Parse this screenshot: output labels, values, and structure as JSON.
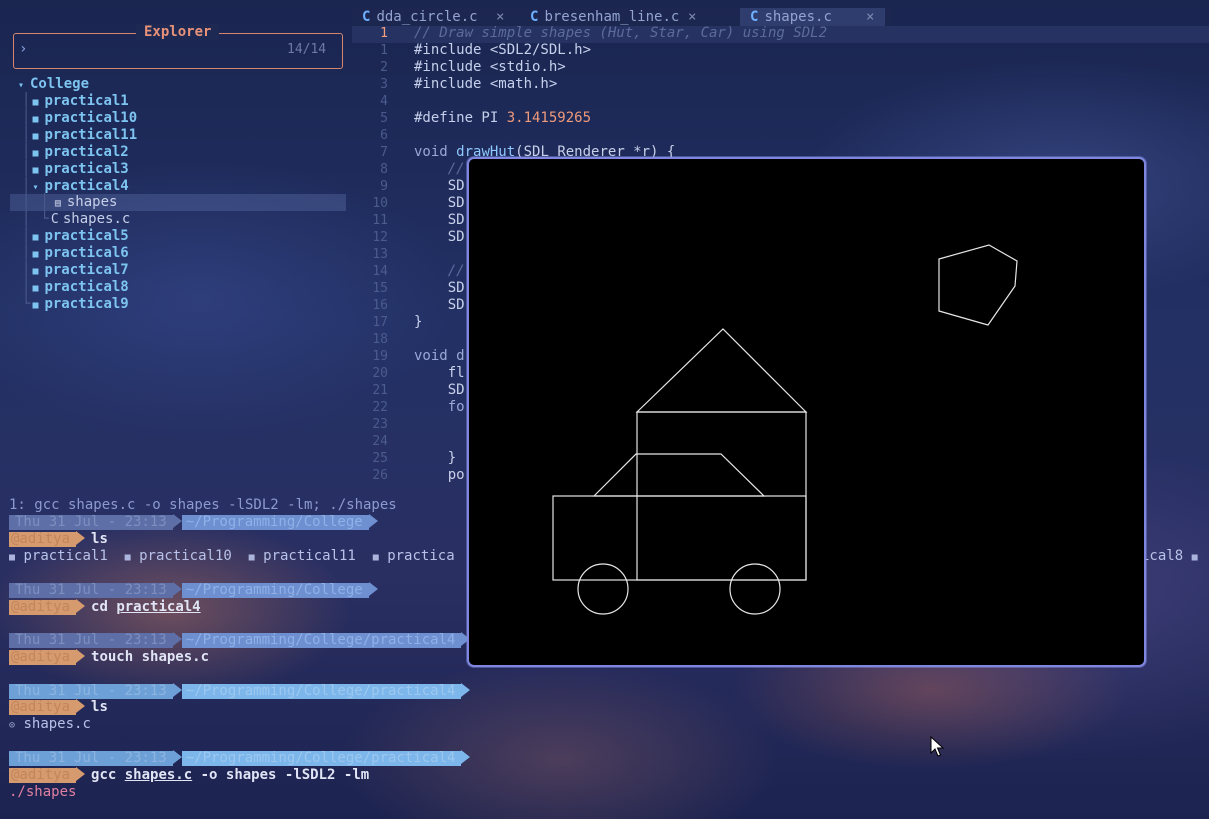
{
  "explorer": {
    "title": "Explorer",
    "prompt": "›",
    "count": "14/14",
    "root": "College",
    "items": [
      {
        "label": "practical1",
        "type": "folder"
      },
      {
        "label": "practical10",
        "type": "folder"
      },
      {
        "label": "practical11",
        "type": "folder"
      },
      {
        "label": "practical2",
        "type": "folder"
      },
      {
        "label": "practical3",
        "type": "folder"
      },
      {
        "label": "practical4",
        "type": "folder-open"
      },
      {
        "label": "shapes",
        "type": "file",
        "selected": true
      },
      {
        "label": "shapes.c",
        "type": "c-file"
      },
      {
        "label": "practical5",
        "type": "folder"
      },
      {
        "label": "practical6",
        "type": "folder"
      },
      {
        "label": "practical7",
        "type": "folder"
      },
      {
        "label": "practical8",
        "type": "folder"
      },
      {
        "label": "practical9",
        "type": "folder"
      }
    ]
  },
  "tabs": [
    {
      "label": "dda_circle.c",
      "close": "×"
    },
    {
      "label": "bresenham_line.c",
      "close": "×"
    },
    {
      "label": "shapes.c",
      "close": "×",
      "active": true
    }
  ],
  "editor": {
    "line_numbers": [
      "1",
      "1",
      "2",
      "3",
      "4",
      "5",
      "6",
      "7",
      "8",
      "9",
      "10",
      "11",
      "12",
      "13",
      "14",
      "15",
      "16",
      "17",
      "18",
      "19",
      "20",
      "21",
      "22",
      "23",
      "24",
      "25",
      "26"
    ],
    "lines": {
      "l0": "// Draw simple shapes (Hut, Star, Car) using SDL2",
      "l1": "#include <SDL2/SDL.h>",
      "l2": "#include <stdio.h>",
      "l3": "#include <math.h>",
      "l5a": "#define PI ",
      "l5b": "3.14159265",
      "l7a": "void ",
      "l7b": "drawHut",
      "l7c": "(SDL_Renderer *r) {",
      "l8": "    //",
      "l9": "    SD",
      "l10": "    SD",
      "l11": "    SD",
      "l12": "    SD",
      "l14": "    //",
      "l15": "    SD",
      "l16": "    SD",
      "l17": "}",
      "l19": "void d",
      "l20": "    fl",
      "l21": "    SD",
      "l22": "    fo",
      "l25": "    }",
      "l26": "    po"
    }
  },
  "terminal": {
    "title": "1: gcc shapes.c -o shapes -lSDL2 -lm; ./shapes",
    "date": "Thu 31 Jul - 23:13",
    "user": "@aditya",
    "path1": "~/Programming/College",
    "path2": "~/Programming/College/practical4",
    "cmd1": "ls",
    "ls1": [
      "practical1",
      "practical10",
      "practical11",
      "practica",
      "ical8"
    ],
    "cmd2a": "cd ",
    "cmd2b": "practical4",
    "cmd3": "touch shapes.c",
    "cmd4": "ls",
    "ls2": "shapes.c",
    "cmd5a": "gcc ",
    "cmd5b": "shapes.c",
    "cmd5c": " -o shapes -lSDL2 -lm",
    "run": "./shapes"
  },
  "colors": {
    "sdl_border": "#7f86e0",
    "folder": "#7dc4f0",
    "accent": "#e8927a"
  }
}
